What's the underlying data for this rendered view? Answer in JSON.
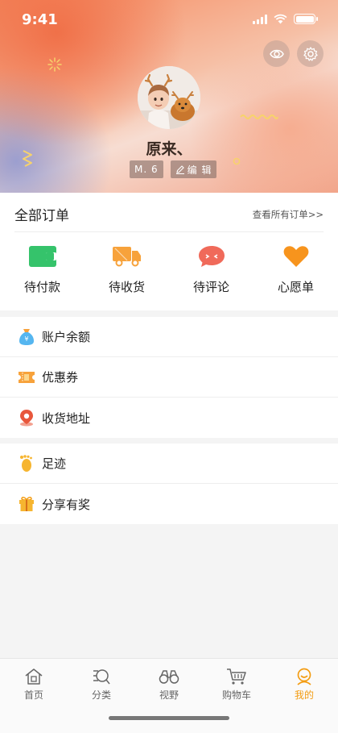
{
  "status_bar": {
    "time": "9:41"
  },
  "profile": {
    "name": "原来、",
    "level": "M. 6",
    "edit_label": "编 辑"
  },
  "orders": {
    "title": "全部订单",
    "view_all": "查看所有订单>>",
    "items": [
      {
        "label": "待付款",
        "icon": "wallet-icon",
        "color": "#35c36b"
      },
      {
        "label": "待收货",
        "icon": "truck-icon",
        "color": "#f7a23b"
      },
      {
        "label": "待评论",
        "icon": "comment-icon",
        "color": "#f06a5a"
      },
      {
        "label": "心愿单",
        "icon": "heart-icon",
        "color": "#f7941d"
      }
    ]
  },
  "menu_group_1": [
    {
      "label": "账户余额",
      "icon": "money-bag-icon"
    },
    {
      "label": "优惠券",
      "icon": "coupon-icon"
    },
    {
      "label": "收货地址",
      "icon": "location-pin-icon"
    }
  ],
  "menu_group_2": [
    {
      "label": "足迹",
      "icon": "footprint-icon"
    },
    {
      "label": "分享有奖",
      "icon": "gift-icon"
    }
  ],
  "tabbar": [
    {
      "label": "首页",
      "icon": "home-icon",
      "active": false
    },
    {
      "label": "分类",
      "icon": "category-search-icon",
      "active": false
    },
    {
      "label": "视野",
      "icon": "binoculars-icon",
      "active": false
    },
    {
      "label": "购物车",
      "icon": "cart-icon",
      "active": false
    },
    {
      "label": "我的",
      "icon": "profile-icon",
      "active": true
    }
  ],
  "colors": {
    "accent": "#f39c12",
    "background": "#f4f4f4"
  }
}
